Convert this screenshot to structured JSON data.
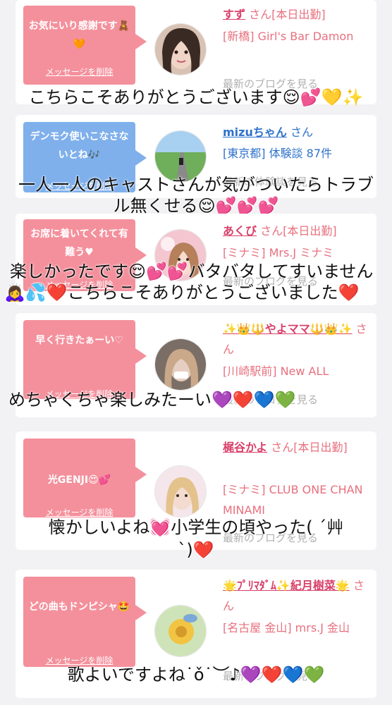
{
  "messages": [
    {
      "bubble_text": "お気にいり感謝です🧸🧡",
      "delete_label": "メッセージを削除",
      "name": "すず",
      "name_suffix": "さん[本日出勤]",
      "shop": "[新橋] Girl's Bar Damon",
      "blog_label": "最新のブログを見る",
      "reply": "こちらこそありがとうございます😌💕💛✨"
    },
    {
      "bubble_text": "デンモク使いこなさないとね🎶",
      "delete_label": "メッセージを削除",
      "name": "mizuちゃん",
      "name_suffix": "さん",
      "shop": "[東京都] 体験談 87件",
      "blog_label": "最新の体験談を見る",
      "reply_line1": "一人一人のキャストさんが気がついたらトラブ",
      "reply_line2": "ル無くせる😌💕💕💕"
    },
    {
      "bubble_text": "お席に着いてくれて有難う♥",
      "delete_label": "メッセージを削除",
      "name": "あくび",
      "name_suffix": "さん[本日出勤]",
      "shop": "[ミナミ] Mrs.J ミナミ",
      "blog_label": "最新のブログを見る",
      "reply_line1": "楽しかったです😌💕💕バタバタしてすいません",
      "reply_line2": "🙇‍♀️💦❤️こちらこそありがとうございました❤️"
    },
    {
      "bubble_text": "早く行きたぁーい♡",
      "delete_label": "メッセージを削除",
      "name": "✨👑🔱やよママ🔱👑✨",
      "name_suffix": "さん",
      "shop": "[川崎駅前] New ALL",
      "blog_label": "最新のブログを見る",
      "reply": "めちゃくちゃ楽しみたーい💜❤️💙💚"
    },
    {
      "bubble_text": "光GENJI😍💕",
      "delete_label": "メッセージを削除",
      "name": "梶谷かよ",
      "name_suffix": "さん[本日出勤]",
      "shop": "[ミナミ] CLUB ONE CHAN MINAMI",
      "blog_label": "最新のブログを見る",
      "reply_line1": "懐かしいよね💓小学生の頃やった( ´艸",
      "reply_line2": "`)❤️"
    },
    {
      "bubble_text": "どの曲もドンピシャ🤩",
      "delete_label": "メッセージを削除",
      "name": "🌟ﾌﾟﾘﾏﾀﾞﾑ✨紀月樹菜🌟",
      "name_suffix": "さん",
      "shop": "[名古屋 金山] mrs.J 金山",
      "blog_label": "最新のブログを見る",
      "reply": "歌よいですよね˙ǒ˙︶♪💜❤️💙💚"
    }
  ],
  "colors": {
    "bubble_pink": "#f4909c",
    "bubble_blue": "#7fb0ec",
    "name_pink": "#d9406a",
    "name_blue": "#2f72cc",
    "background": "#f2f2f4"
  }
}
